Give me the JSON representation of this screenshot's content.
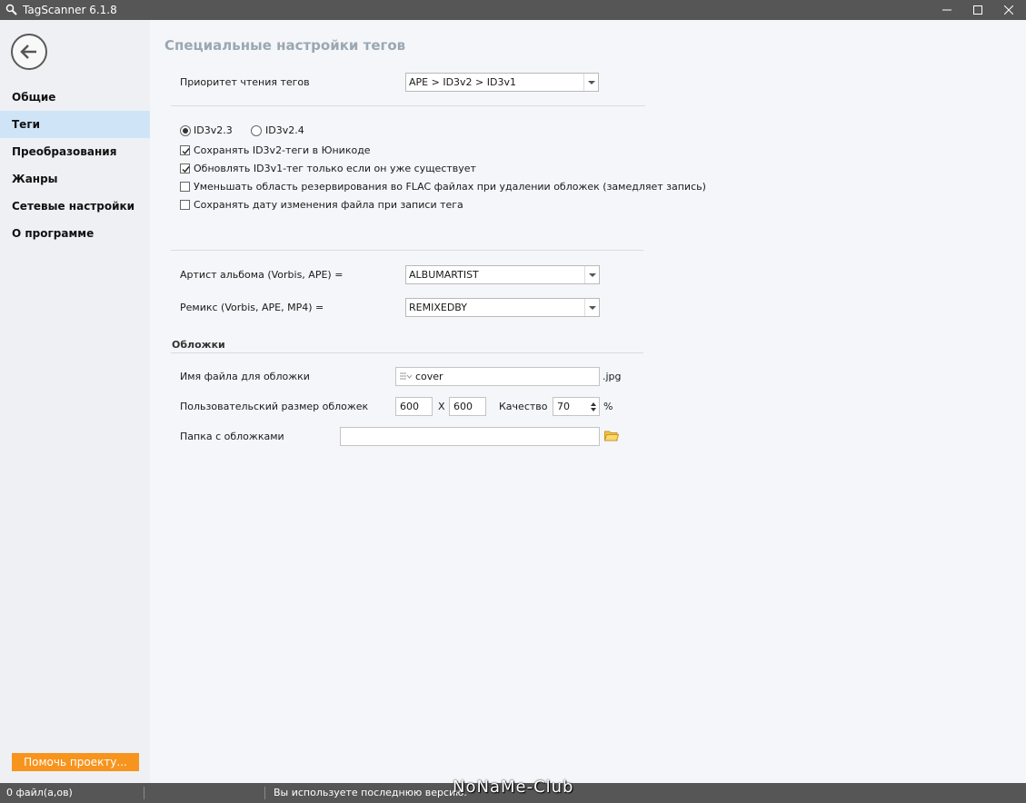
{
  "window": {
    "title": "TagScanner 6.1.8"
  },
  "sidebar": {
    "items": [
      {
        "label": "Общие"
      },
      {
        "label": "Теги"
      },
      {
        "label": "Преобразования"
      },
      {
        "label": "Жанры"
      },
      {
        "label": "Сетевые настройки"
      },
      {
        "label": "О программе"
      }
    ],
    "active_index": 1,
    "donate_label": "Помочь проекту..."
  },
  "main": {
    "title": "Специальные настройки тегов",
    "read_priority": {
      "label": "Приоритет чтения тегов",
      "value": "APE > ID3v2 > ID3v1"
    },
    "id3_version": {
      "options": [
        {
          "label": "ID3v2.3",
          "checked": true
        },
        {
          "label": "ID3v2.4",
          "checked": false
        }
      ]
    },
    "checkboxes": [
      {
        "label": "Сохранять ID3v2-теги в Юникоде",
        "checked": true
      },
      {
        "label": "Обновлять ID3v1-тег только если он уже существует",
        "checked": true
      },
      {
        "label": "Уменьшать область резервирования во FLAC файлах при удалении обложек  (замедляет запись)",
        "checked": false
      },
      {
        "label": "Сохранять дату изменения файла при записи тега",
        "checked": false
      }
    ],
    "album_artist": {
      "label": "Артист альбома (Vorbis, APE) =",
      "value": "ALBUMARTIST"
    },
    "remix": {
      "label": "Ремикс (Vorbis, APE, MP4) =",
      "value": "REMIXEDBY"
    },
    "covers": {
      "header": "Обложки",
      "filename_label": "Имя файла для обложки",
      "filename_value": "cover",
      "filename_ext": ".jpg",
      "size_label": "Пользовательский размер обложек",
      "width": "600",
      "x_label": "X",
      "height": "600",
      "quality_label": "Качество",
      "quality_value": "70",
      "percent_label": "%",
      "folder_label": "Папка с обложками",
      "folder_value": ""
    }
  },
  "status": {
    "files": "0 файл(а,ов)",
    "message": "Вы используете последнюю версию.",
    "watermark": "NoNaMe-Club"
  },
  "colors": {
    "titlebar": "#565656",
    "active_nav": "#cfe5f7",
    "donate": "#f7941d",
    "section_title": "#9ba7b2"
  }
}
